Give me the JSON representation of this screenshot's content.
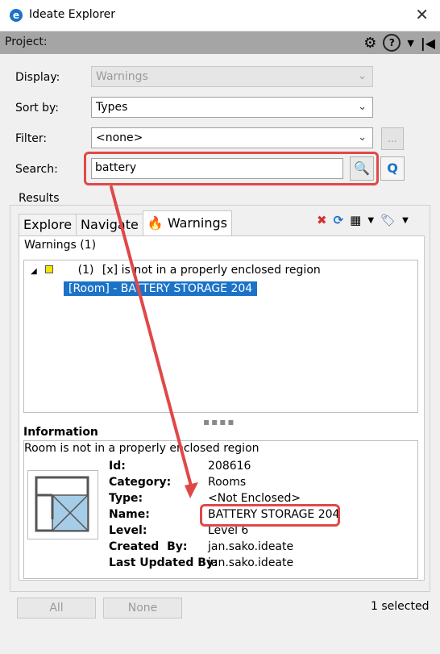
{
  "window": {
    "title": "Ideate Explorer"
  },
  "project": {
    "label": "Project:"
  },
  "display": {
    "label": "Display:",
    "value": "Warnings"
  },
  "sort": {
    "label": "Sort by:",
    "value": "Types"
  },
  "filter": {
    "label": "Filter:",
    "value": "<none>",
    "more": "..."
  },
  "search": {
    "label": "Search:",
    "value": "battery"
  },
  "results": {
    "label": "Results",
    "tabs": [
      "Explore",
      "Navigate",
      "Warnings"
    ],
    "header": "Warnings (1)",
    "tree": {
      "count": "(1)",
      "warning_text": "[x] is not in a properly enclosed region",
      "selected_item": "[Room] - BATTERY STORAGE 204"
    }
  },
  "info": {
    "title": "Information",
    "description": "Room is not in a properly enclosed region",
    "fields": [
      {
        "key": "Id:",
        "value": "208616"
      },
      {
        "key": "Category:",
        "value": "Rooms"
      },
      {
        "key": "Type:",
        "value": "<Not Enclosed>"
      },
      {
        "key": "Name:",
        "value": "BATTERY STORAGE 204"
      },
      {
        "key": "Level:",
        "value": "Level 6"
      },
      {
        "key": "Created  By:",
        "value": "jan.sako.ideate"
      },
      {
        "key": "Last Updated By:",
        "value": "jan.sako.ideate"
      }
    ]
  },
  "footer": {
    "all": "All",
    "none": "None",
    "selected": "1 selected"
  },
  "colors": {
    "accent": "#1b73c8",
    "highlight": "#e04848",
    "project_bar": "#a5a5a5"
  }
}
